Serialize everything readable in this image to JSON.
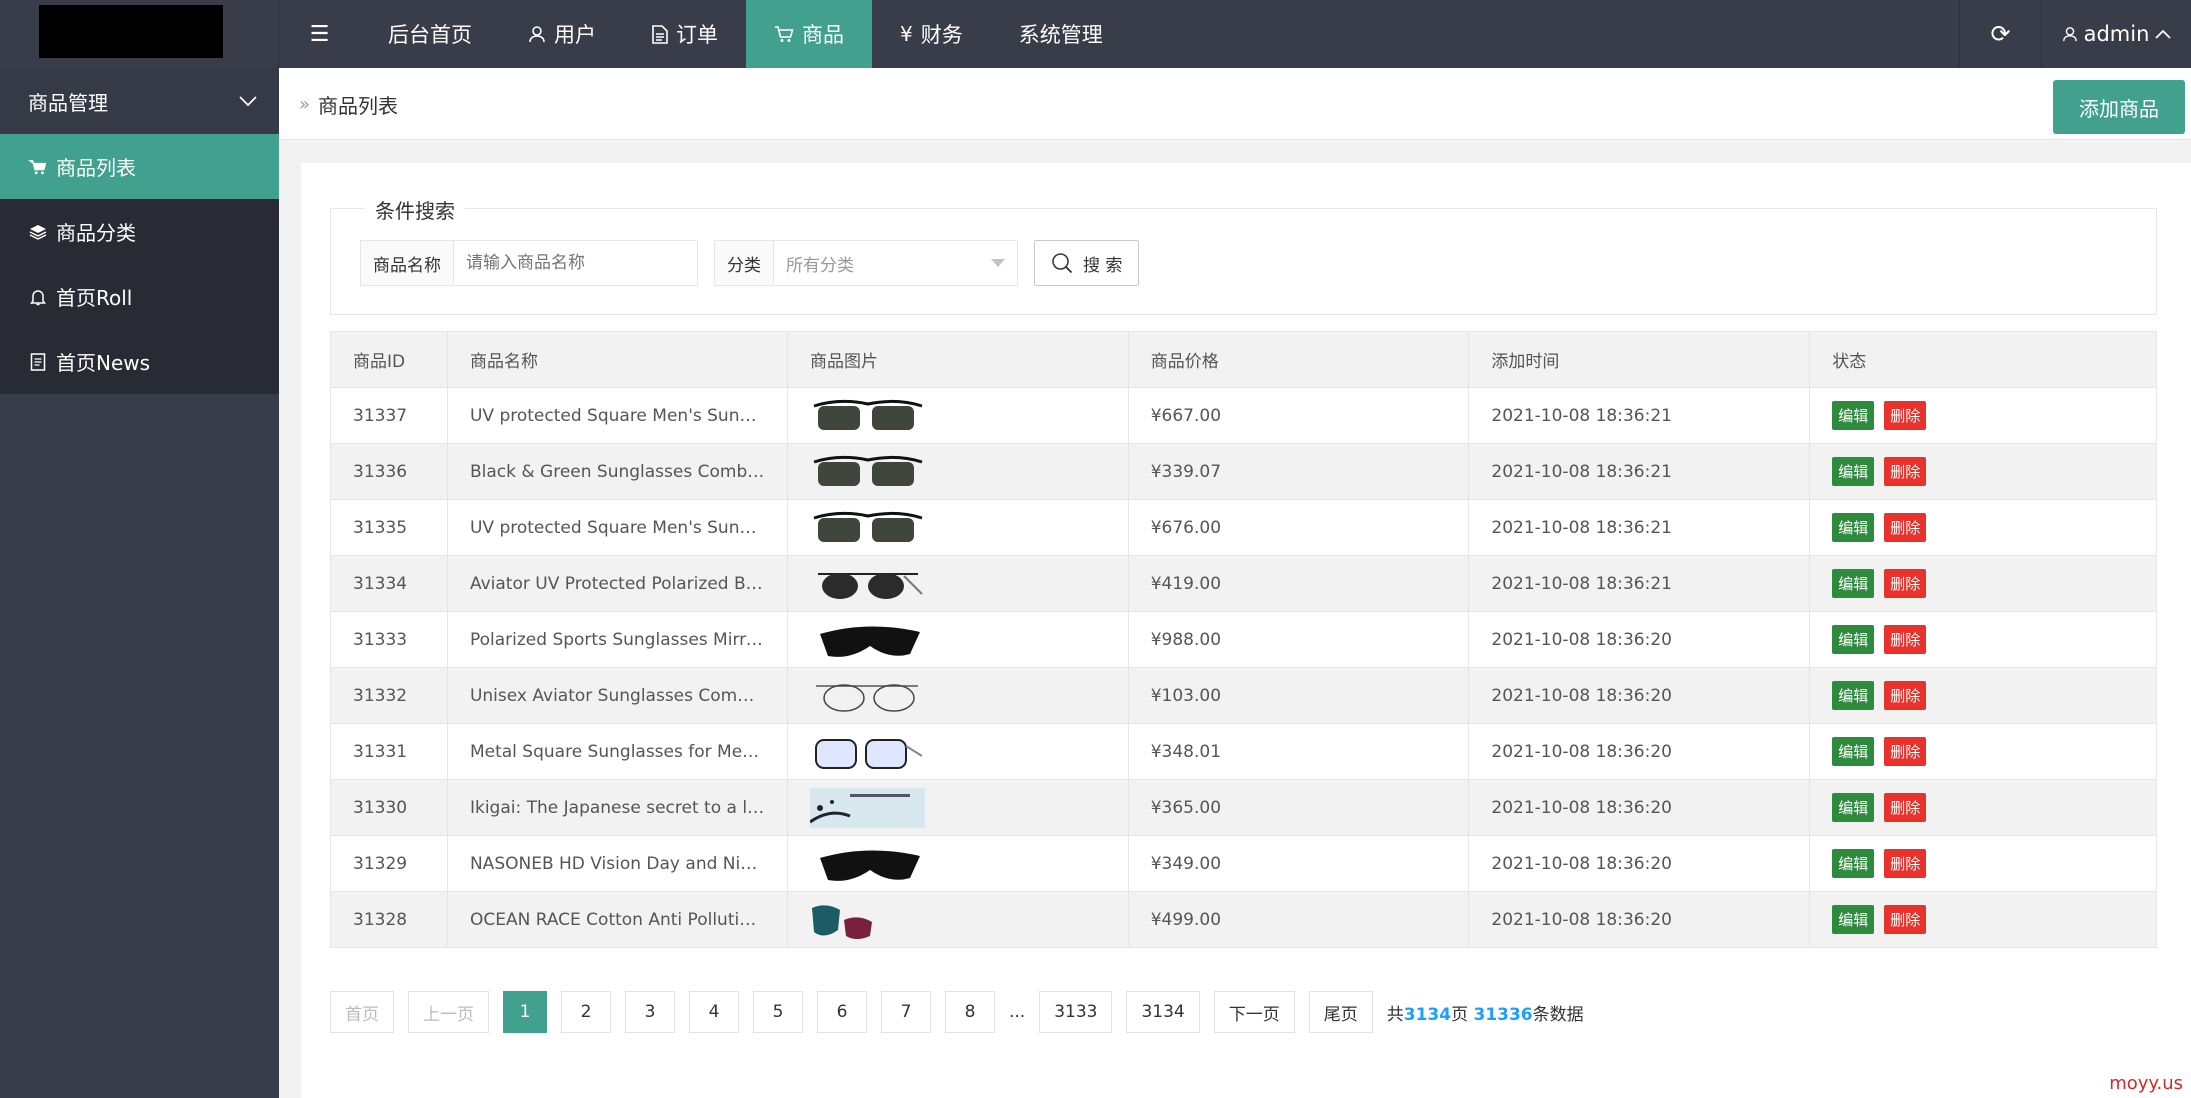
{
  "topbar": {
    "nav": [
      {
        "label": "后台首页",
        "icon": ""
      },
      {
        "label": "用户",
        "icon": "user-icon"
      },
      {
        "label": "订单",
        "icon": "document-icon"
      },
      {
        "label": "商品",
        "icon": "cart-icon",
        "active": true
      },
      {
        "label": "财务",
        "icon": "yen-icon"
      },
      {
        "label": "系统管理",
        "icon": ""
      }
    ],
    "user": "admin"
  },
  "sidebar": {
    "header": "商品管理",
    "items": [
      {
        "label": "商品列表",
        "icon": "cart-icon",
        "active": true
      },
      {
        "label": "商品分类",
        "icon": "layers-icon"
      },
      {
        "label": "首页Roll",
        "icon": "bell-icon"
      },
      {
        "label": "首页News",
        "icon": "news-icon"
      }
    ]
  },
  "breadcrumb": {
    "label": "商品列表"
  },
  "add_button": "添加商品",
  "search": {
    "legend": "条件搜索",
    "name_label": "商品名称",
    "name_placeholder": "请输入商品名称",
    "category_label": "分类",
    "category_value": "所有分类",
    "button": "搜 索"
  },
  "table": {
    "headers": [
      "商品ID",
      "商品名称",
      "商品图片",
      "商品价格",
      "添加时间",
      "状态"
    ],
    "edit_label": "编辑",
    "delete_label": "删除",
    "rows": [
      {
        "id": "31337",
        "name": "UV protected Square Men's Sungla…",
        "price": "¥667.00",
        "time": "2021-10-08 18:36:21",
        "img": "sunglasses"
      },
      {
        "id": "31336",
        "name": "Black & Green Sunglasses Combo …",
        "price": "¥339.07",
        "time": "2021-10-08 18:36:21",
        "img": "sunglasses"
      },
      {
        "id": "31335",
        "name": "UV protected Square Men's Sungla…",
        "price": "¥676.00",
        "time": "2021-10-08 18:36:21",
        "img": "sunglasses"
      },
      {
        "id": "31334",
        "name": "Aviator UV Protected Polarized Blac…",
        "price": "¥419.00",
        "time": "2021-10-08 18:36:21",
        "img": "aviator"
      },
      {
        "id": "31333",
        "name": "Polarized Sports Sunglasses Mirror …",
        "price": "¥988.00",
        "time": "2021-10-08 18:36:20",
        "img": "sport"
      },
      {
        "id": "31332",
        "name": "Unisex Aviator Sunglasses Combo (…",
        "price": "¥103.00",
        "time": "2021-10-08 18:36:20",
        "img": "aviator-thin"
      },
      {
        "id": "31331",
        "name": "Metal Square Sunglasses for Men a…",
        "price": "¥348.01",
        "time": "2021-10-08 18:36:20",
        "img": "clear"
      },
      {
        "id": "31330",
        "name": "Ikigai: The Japanese secret to a lon…",
        "price": "¥365.00",
        "time": "2021-10-08 18:36:20",
        "img": "book"
      },
      {
        "id": "31329",
        "name": "NASONEB HD Vision Day and Night…",
        "price": "¥349.00",
        "time": "2021-10-08 18:36:20",
        "img": "sport"
      },
      {
        "id": "31328",
        "name": "OCEAN RACE Cotton Anti Pollution…",
        "price": "¥499.00",
        "time": "2021-10-08 18:36:20",
        "img": "mask"
      }
    ]
  },
  "pagination": {
    "first": "首页",
    "prev": "上一页",
    "pages": [
      "1",
      "2",
      "3",
      "4",
      "5",
      "6",
      "7",
      "8"
    ],
    "ellipsis": "...",
    "tail_pages": [
      "3133",
      "3134"
    ],
    "next": "下一页",
    "last": "尾页",
    "total_prefix": "共",
    "total_pages": "3134",
    "pages_suffix": "页",
    "total_records": "31336",
    "records_suffix": "条数据"
  },
  "watermark": "moyy.us",
  "colors": {
    "accent": "#41a08e",
    "dark": "#393d49",
    "edit": "#2e8b3d",
    "delete": "#e8322c",
    "link": "#1e9fff"
  }
}
